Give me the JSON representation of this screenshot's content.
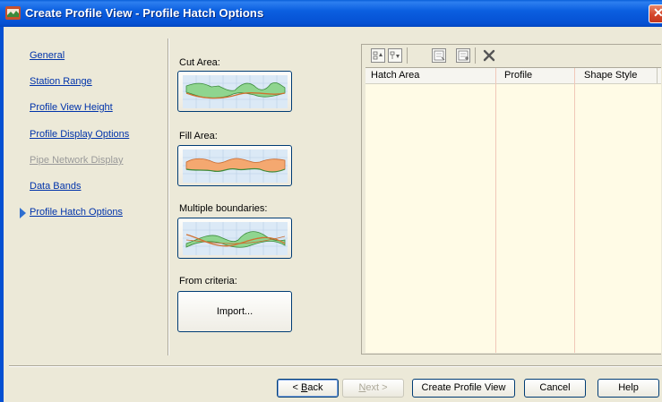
{
  "window": {
    "title": "Create Profile View - Profile Hatch Options"
  },
  "nav": {
    "items": [
      {
        "label": "General",
        "state": "link"
      },
      {
        "label": "Station Range",
        "state": "link"
      },
      {
        "label": "Profile View Height",
        "state": "link"
      },
      {
        "label": "Profile Display Options",
        "state": "link"
      },
      {
        "label": "Pipe Network Display",
        "state": "disabled"
      },
      {
        "label": "Data Bands",
        "state": "link"
      },
      {
        "label": "Profile Hatch Options",
        "state": "current"
      }
    ]
  },
  "options": {
    "cut_area_label": "Cut Area:",
    "fill_area_label": "Fill Area:",
    "multiple_boundaries_label": "Multiple boundaries:",
    "from_criteria_label": "From criteria:",
    "import_label": "Import..."
  },
  "table": {
    "toolbar_icons": [
      "move-up-icon",
      "move-down-icon",
      "add-row-icon",
      "insert-row-icon",
      "delete-icon"
    ],
    "columns": [
      "Hatch Area",
      "Profile",
      "Shape Style"
    ],
    "rows": []
  },
  "footer": {
    "back_prefix": "< ",
    "back_key": "B",
    "back_rest": "ack",
    "next_key": "N",
    "next_rest": "ext >",
    "create_label": "Create Profile View",
    "cancel_label": "Cancel",
    "help_label": "Help"
  },
  "colors": {
    "titlebar": "#0550d2",
    "link": "#0033aa",
    "grid_background": "#fffbe6",
    "cut_fill": "#8fd58f",
    "fill_fill": "#f4a870"
  }
}
